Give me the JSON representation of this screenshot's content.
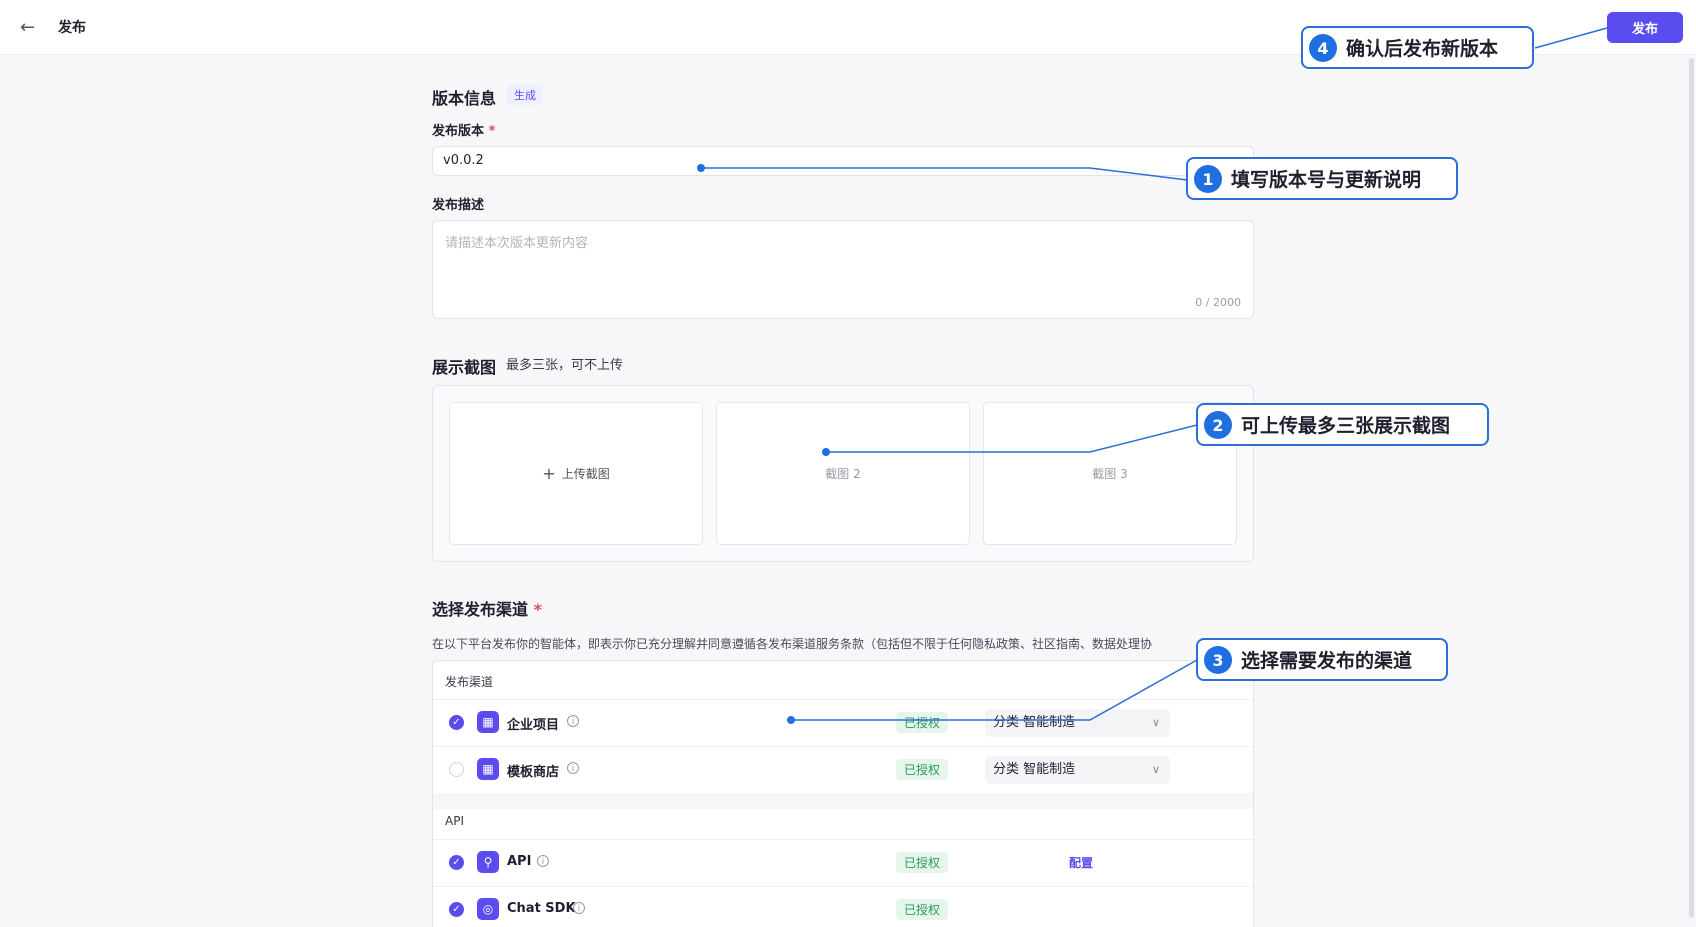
{
  "header": {
    "title": "发布",
    "publish_label": "发布"
  },
  "version_info": {
    "title": "版本信息",
    "generate_tag": "生成",
    "version_label": "发布版本",
    "required_mark": "*",
    "version_value": "v0.0.2",
    "desc_label": "发布描述",
    "desc_placeholder": "请描述本次版本更新内容",
    "desc_counter": "0 / 2000"
  },
  "screenshots": {
    "title": "展示截图",
    "note": "最多三张，可不上传",
    "upload_label": "上传截图",
    "slots": [
      "截图 2",
      "截图 3"
    ]
  },
  "channels": {
    "title": "选择发布渠道",
    "required_mark": "*",
    "terms": "在以下平台发布你的智能体，即表示你已充分理解并同意遵循各发布渠道服务条款（包括但不限于任何隐私政策、社区指南、数据处理协",
    "groups": [
      {
        "title": "发布渠道",
        "items": [
          {
            "name": "企业项目",
            "checked": true,
            "status": "已授权",
            "select": "分类 智能制造"
          },
          {
            "name": "模板商店",
            "checked": false,
            "status": "已授权",
            "select": "分类 智能制造"
          }
        ]
      },
      {
        "title": "API",
        "items": [
          {
            "name": "API",
            "checked": true,
            "status": "已授权",
            "action": "配置"
          },
          {
            "name": "Chat SDK",
            "checked": true,
            "status": "已授权"
          }
        ]
      }
    ]
  },
  "annotations": [
    {
      "num": "1",
      "text": "填写版本号与更新说明"
    },
    {
      "num": "2",
      "text": "可上传最多三张展示截图"
    },
    {
      "num": "3",
      "text": "选择需要发布的渠道"
    },
    {
      "num": "4",
      "text": "确认后发布新版本"
    }
  ],
  "colors": {
    "accent": "#5b4cf0",
    "callout": "#1f6fe0",
    "auth_green": "#2b9a5b"
  }
}
